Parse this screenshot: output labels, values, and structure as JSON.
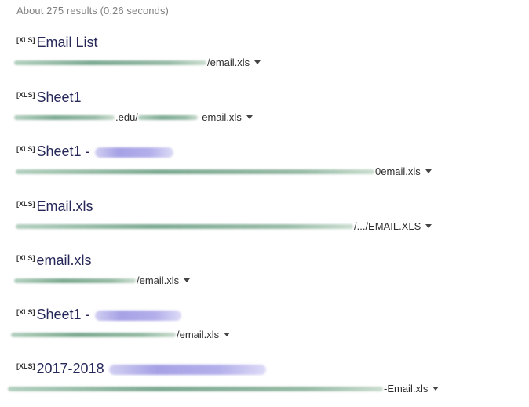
{
  "search_stats": "About 275 results (0.26 seconds)",
  "results": [
    {
      "filetype": "[XLS]",
      "title": "Email List",
      "url_visible": "/email.xls"
    },
    {
      "filetype": "[XLS]",
      "title": "Sheet1",
      "url_visible": ".edu/",
      "url_visible_end": "-email.xls"
    },
    {
      "filetype": "[XLS]",
      "title": "Sheet1 -",
      "url_visible": "0email.xls"
    },
    {
      "filetype": "[XLS]",
      "title": "Email.xls",
      "url_visible": "/.../EMAIL.XLS"
    },
    {
      "filetype": "[XLS]",
      "title": "email.xls",
      "url_visible": "/email.xls"
    },
    {
      "filetype": "[XLS]",
      "title": "Sheet1 -",
      "url_visible": "/email.xls"
    },
    {
      "filetype": "[XLS]",
      "title": "2017-2018",
      "url_visible": "-Email.xls"
    }
  ]
}
